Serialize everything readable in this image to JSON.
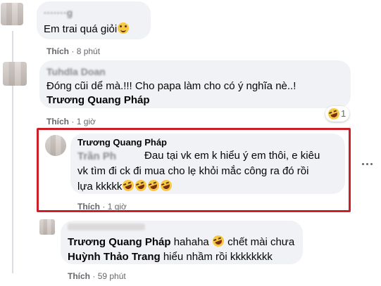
{
  "comments": [
    {
      "author_blurred": "·······g",
      "text": "Em trai quá giỏi",
      "emoji": "smile-emoji",
      "actions": {
        "like": "Thích",
        "time": "8 phút"
      }
    },
    {
      "author_blurred": "Tuhdla Doan",
      "text_line1": "Đóng cũi dể mà.!!! Cho papa làm cho có ý nghĩa nè..!",
      "mention": "Trương Quang Pháp",
      "actions": {
        "like": "Thích",
        "time": "1 giờ"
      },
      "reaction": {
        "emoji": "rofl-emoji",
        "count": "1"
      }
    },
    {
      "author": "Trương Quang Pháp",
      "blurred_mention": "Trần Ph",
      "text_line1": "Đau tại vk em k hiểu ý em thôi, e kiêu",
      "text_line2": "vk tìm đi ck đi mua cho lẹ khỏi mắc công ra đó rồi",
      "text_line3": "lựa kkkkk",
      "emojis": [
        "rofl-emoji",
        "rofl-emoji",
        "rofl-emoji",
        "rofl-emoji"
      ],
      "actions": {
        "like": "Thích",
        "time": "1 giờ"
      },
      "highlighted": true
    },
    {
      "mention1": "Trương Quang Pháp",
      "text_part1": "hahaha",
      "text_part2": "chết mài chưa",
      "mention2": "Huỳnh Thảo Trang",
      "text_part3": "hiểu nhầm rồi kkkkkkkk",
      "actions": {
        "like": "Thích",
        "time": "59 phút"
      }
    }
  ],
  "colors": {
    "bubble": "#f0f2f5",
    "highlight": "#cc1f27",
    "meta": "#65676b",
    "text": "#050505"
  },
  "icons": {
    "more_options": "more-options-icon"
  }
}
